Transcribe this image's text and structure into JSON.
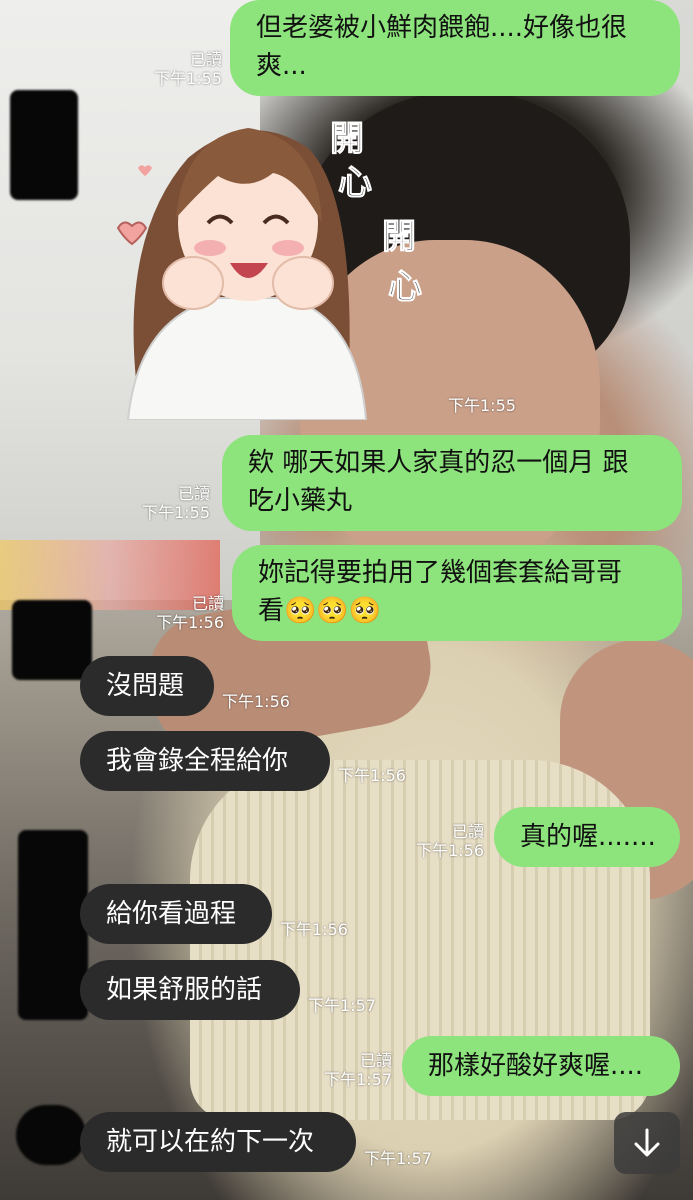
{
  "chat": {
    "messages": [
      {
        "id": "m1",
        "side": "out",
        "lines": [
          "但老婆被小鮮肉餵飽....好像也很",
          "爽..."
        ],
        "read": "已讀",
        "time": "下午1:55"
      },
      {
        "id": "m2",
        "side": "in",
        "type": "sticker",
        "sticker_text": [
          "開",
          "心",
          "開",
          "心"
        ],
        "time": "下午1:55"
      },
      {
        "id": "m3",
        "side": "out",
        "lines": [
          "欸 哪天如果人家真的忍一個月 跟",
          "吃小藥丸"
        ],
        "read": "已讀",
        "time": "下午1:55"
      },
      {
        "id": "m4",
        "side": "out",
        "lines": [
          "妳記得要拍用了幾個套套給哥哥",
          "看🥺🥺🥺"
        ],
        "read": "已讀",
        "time": "下午1:56"
      },
      {
        "id": "m5",
        "side": "in",
        "text": "沒問題",
        "time": "下午1:56"
      },
      {
        "id": "m6",
        "side": "in",
        "text": "我會錄全程給你",
        "time": "下午1:56"
      },
      {
        "id": "m7",
        "side": "out",
        "text": "真的喔.......",
        "read": "已讀",
        "time": "下午1:56"
      },
      {
        "id": "m8",
        "side": "in",
        "text": "給你看過程",
        "time": "下午1:56"
      },
      {
        "id": "m9",
        "side": "in",
        "text": "如果舒服的話",
        "time": "下午1:57"
      },
      {
        "id": "m10",
        "side": "out",
        "text": "那樣好酸好爽喔....",
        "read": "已讀",
        "time": "下午1:57"
      },
      {
        "id": "m11",
        "side": "in",
        "text": "就可以在約下一次",
        "time": "下午1:57"
      }
    ]
  },
  "controls": {
    "scroll_down_icon": "arrow-down-icon"
  },
  "colors": {
    "outgoing_bubble": "#8de37c",
    "incoming_bubble": "#2b2b2b",
    "meta_text": "#ffffff"
  }
}
